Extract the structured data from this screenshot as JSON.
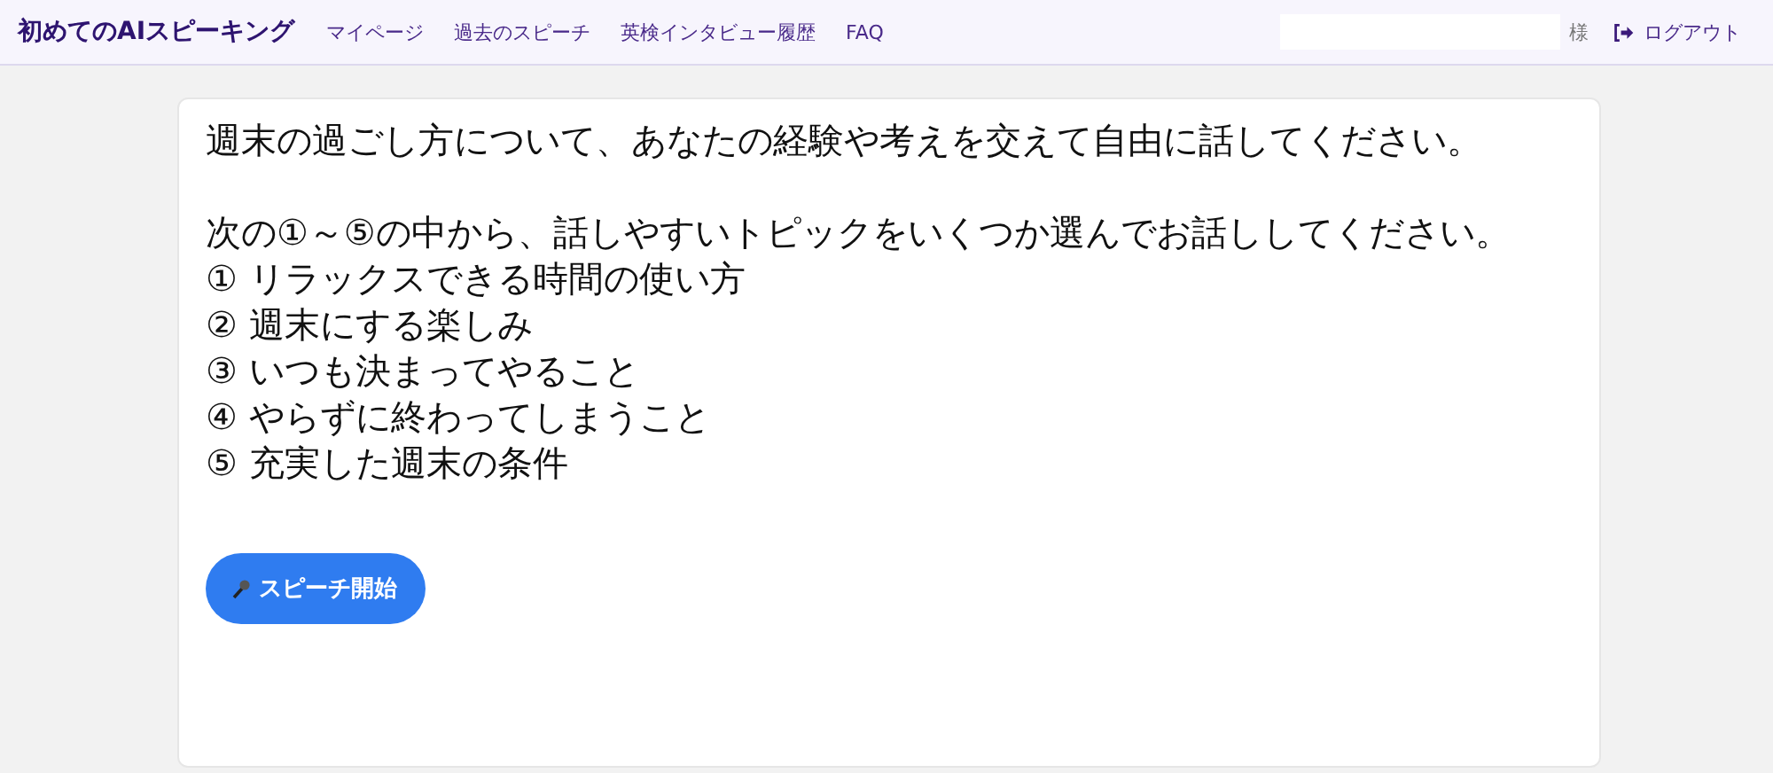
{
  "navbar": {
    "brand": "初めてのAIスピーキング",
    "links": [
      {
        "label": "マイページ"
      },
      {
        "label": "過去のスピーチ"
      },
      {
        "label": "英検インタビュー履歴"
      },
      {
        "label": "FAQ"
      }
    ],
    "honorific": "様",
    "logout": "ログアウト"
  },
  "prompt": {
    "intro": "週末の過ごし方について、あなたの経験や考えを交えて自由に話してください。",
    "instruction": "次の①～⑤の中から、話しやすいトピックをいくつか選んでお話ししてください。",
    "topics": [
      "① リラックスできる時間の使い方",
      "② 週末にする楽しみ",
      "③ いつも決まってやること",
      "④ やらずに終わってしまうこと",
      "⑤ 充実した週末の条件"
    ]
  },
  "start_button": "スピーチ開始"
}
